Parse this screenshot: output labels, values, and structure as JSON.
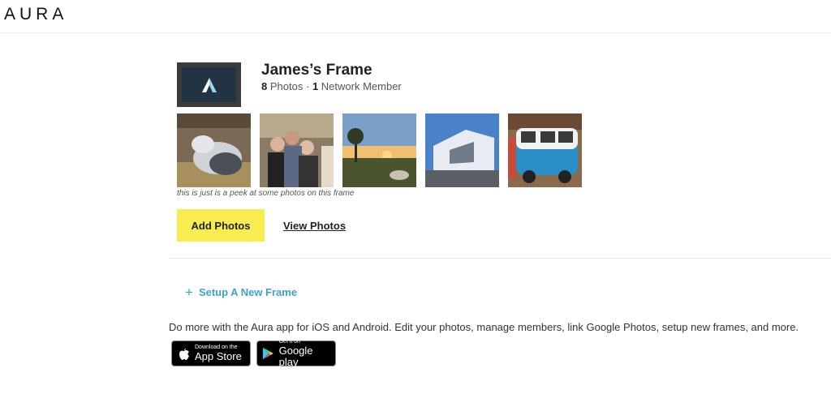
{
  "header": {
    "brand": "AURA"
  },
  "frame": {
    "title": "James’s Frame",
    "photo_count": "8",
    "photo_label": "Photos",
    "separator": "·",
    "member_count": "1",
    "member_label": "Network Member",
    "peek_note": "this is just is a peek at some photos on this frame",
    "photos": [
      "goats",
      "group-selfie",
      "sunset-landscape",
      "modern-building",
      "blue-vw-van"
    ]
  },
  "actions": {
    "add_photos": "Add Photos",
    "view_photos": "View Photos",
    "setup_plus": "+",
    "setup_new_frame": "Setup A New Frame"
  },
  "promo": {
    "text": "Do more with the Aura app for iOS and Android. Edit your photos, manage members, link Google Photos, setup new frames, and more.",
    "app_store": {
      "small": "Download on the",
      "big": "App Store"
    },
    "google_play": {
      "small": "Get it on",
      "big": "Google play"
    }
  },
  "colors": {
    "accent_yellow": "#f7ec50",
    "link_blue": "#3fa0d0"
  }
}
